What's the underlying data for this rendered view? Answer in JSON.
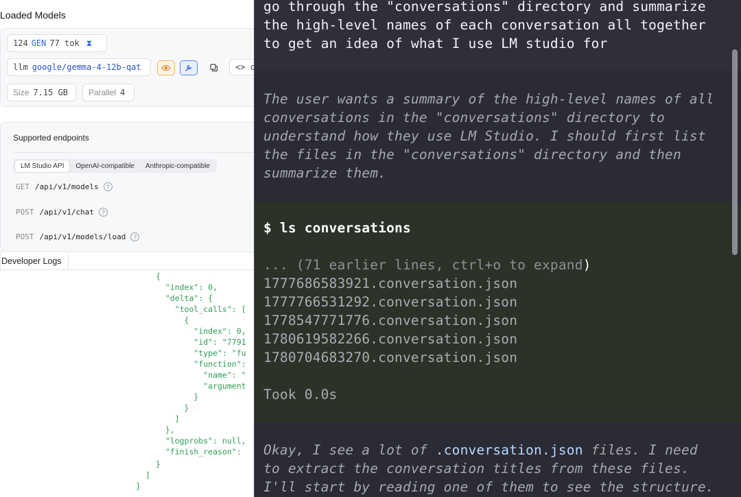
{
  "left": {
    "title": "Loaded Models",
    "stats": {
      "count": "124",
      "gen_label": "GEN",
      "tokens": "77 tok"
    },
    "model": {
      "prefix": "llm",
      "name": "google/gemma-4-12b-qat"
    },
    "code_label": "<> c",
    "size": {
      "label": "Size",
      "value": "7.15 GB"
    },
    "parallel": {
      "label": "Parallel",
      "value": "4"
    },
    "endpoints": {
      "title": "Supported endpoints",
      "tabs": [
        "LM Studio API",
        "OpenAI-compatible",
        "Anthropic-compatible"
      ],
      "rows": [
        {
          "method": "GET",
          "path": "/api/v1/models"
        },
        {
          "method": "POST",
          "path": "/api/v1/chat"
        },
        {
          "method": "POST",
          "path": "/api/v1/models/load"
        }
      ]
    },
    "dev_logs_label": "Developer Logs",
    "log_lines": [
      "{",
      "  \"index\": 0,",
      "  \"delta\": {",
      "    \"tool_calls\": [",
      "      {",
      "        \"index\": 0,",
      "        \"id\": \"7791",
      "        \"type\": \"fu",
      "        \"function\":",
      "          \"name\": \"",
      "          \"argument",
      "        }",
      "      }",
      "    ]",
      "  },",
      "  \"logprobs\": null,",
      "  \"finish_reason\":",
      "}",
      "]",
      "}"
    ]
  },
  "terminal": {
    "user_prompt": [
      "go through the \"conversations\" directory and summarize",
      "the high-level names of each conversation all together",
      "to get an idea of what I use LM studio for"
    ],
    "thought": [
      "The user wants a summary of the high-level names of all",
      "conversations in the \"conversations\" directory to",
      "understand how they use LM Studio. I should first list",
      "the files in the \"conversations\" directory and then",
      "summarize them."
    ],
    "command": "$ ls conversations",
    "collapsed": {
      "prefix": "... (71 earlier lines, ",
      "key": "ctrl+o",
      "suffix": " to expand",
      "paren": ")"
    },
    "files": [
      "1777686583921.conversation.json",
      "1777766531292.conversation.json",
      "1778547771776.conversation.json",
      "1780619582266.conversation.json",
      "1780704683270.conversation.json"
    ],
    "took": "Took 0.0s",
    "reply": {
      "line1_a": "Okay, I see a lot of ",
      "line1_hl": ".conversation.json",
      "line1_b": " files. I need",
      "line2": "to extract the conversation titles from these files.",
      "line3": "I'll start by reading one of them to see the structure."
    }
  }
}
